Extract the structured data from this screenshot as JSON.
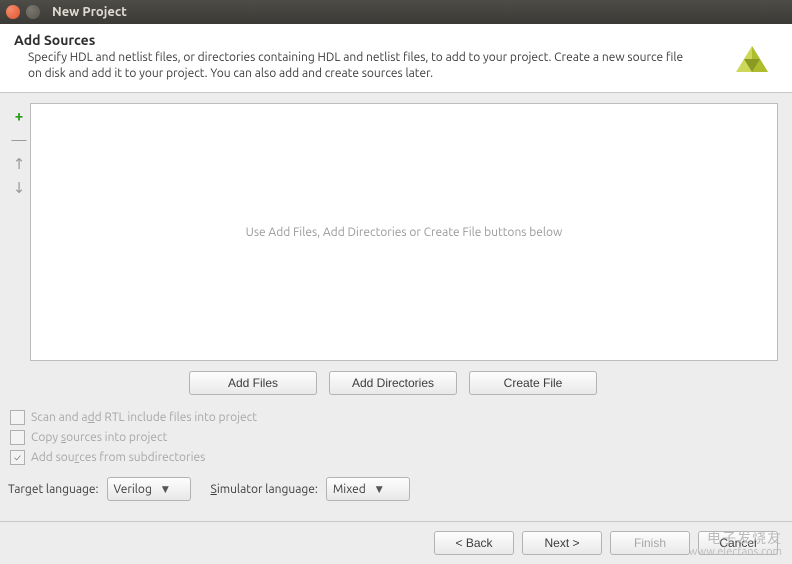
{
  "window": {
    "title": "New Project"
  },
  "header": {
    "title": "Add Sources",
    "desc": "Specify HDL and netlist files, or directories containing HDL and netlist files, to add to your project. Create a new source file on disk and add it to your project. You can also add and create sources later."
  },
  "sources": {
    "placeholder": "Use Add Files, Add Directories or Create File buttons below",
    "buttons": {
      "add_files": "Add Files",
      "add_dirs": "Add Directories",
      "create_file": "Create File"
    }
  },
  "checks": {
    "scan_pre": "Scan and a",
    "scan_u": "d",
    "scan_post": "d RTL include files into project",
    "copy_pre": "Copy ",
    "copy_u": "s",
    "copy_post": "ources into project",
    "sub_pre": "Add sou",
    "sub_u": "r",
    "sub_post": "ces from subdirectories"
  },
  "lang": {
    "target_pre": "Tar",
    "target_u": "g",
    "target_post": "et language:",
    "target_value": "Verilog",
    "sim_pre": "",
    "sim_u": "S",
    "sim_post": "imulator language:",
    "sim_value": "Mixed"
  },
  "footer": {
    "back": "< Back",
    "next": "Next >",
    "finish": "Finish",
    "cancel": "Cancel"
  },
  "watermark": {
    "zh": "电子发烧友",
    "en": "www.elecfans.com"
  }
}
